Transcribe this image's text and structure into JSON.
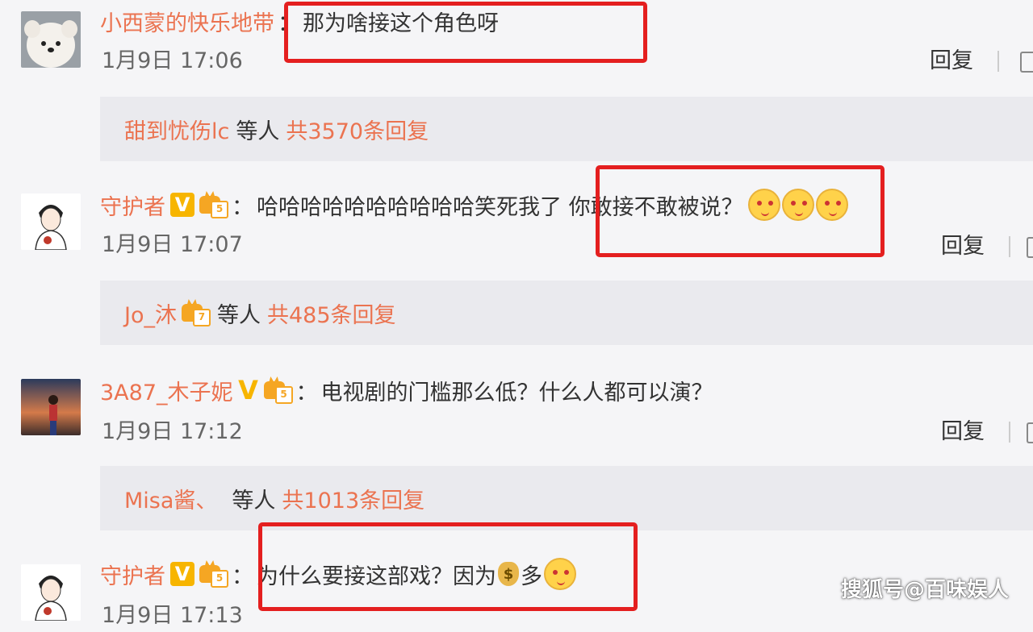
{
  "comments": [
    {
      "username": "小西蒙的快乐地带",
      "colon": "：",
      "text": "那为啥接这个角色呀",
      "date": "1月9日 17:06",
      "reply_label": "回复",
      "replies": {
        "names": "甜到忧伤lc",
        "mid": "等人",
        "count": "共3570条回复"
      }
    },
    {
      "username": "守护者",
      "badge_v": "V",
      "badge_level": "5",
      "colon": "：",
      "text": "哈哈哈哈哈哈哈哈哈哈笑死我了 你敢接不敢被说？",
      "date": "1月9日 17:07",
      "reply_label": "回复",
      "replies": {
        "names": "Jo_沐",
        "badge_level": "7",
        "mid": "等人",
        "count": "共485条回复"
      }
    },
    {
      "username": "3A87_木子妮",
      "badge_v": "V",
      "badge_level": "5",
      "colon": "：",
      "text": "电视剧的门槛那么低？什么人都可以演？",
      "date": "1月9日 17:12",
      "reply_label": "回复",
      "replies": {
        "names": "Misa酱、",
        "mid": "等人",
        "count": "共1013条回复"
      }
    },
    {
      "username": "守护者",
      "badge_v": "V",
      "badge_level": "5",
      "colon": "：",
      "text_before": "为什么要接这部戏？因为",
      "money_glyph": "$",
      "text_after": "多",
      "date": "1月9日 17:13"
    }
  ],
  "watermark": "搜狐号@百味娱人",
  "colors": {
    "username": "#eb7350",
    "highlight": "#e41f1f",
    "vip_badge": "#f7b500"
  },
  "icons": [
    "like-icon",
    "doge-emoji-icon",
    "money-bag-icon",
    "crown-level-badge-icon",
    "vip-v-badge-icon"
  ]
}
